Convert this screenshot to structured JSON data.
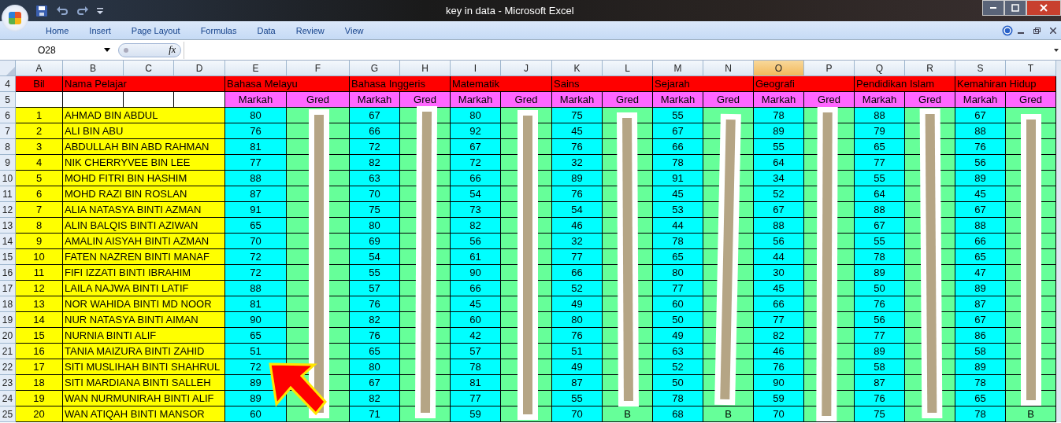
{
  "window": {
    "title": "key in data - Microsoft Excel"
  },
  "ribbon_tabs": [
    {
      "label": "Home",
      "selected": false
    },
    {
      "label": "Insert",
      "selected": false
    },
    {
      "label": "Page Layout",
      "selected": false
    },
    {
      "label": "Formulas",
      "selected": false
    },
    {
      "label": "Data",
      "selected": false
    },
    {
      "label": "Review",
      "selected": false
    },
    {
      "label": "View",
      "selected": false
    }
  ],
  "formula_bar": {
    "name_box": "O28",
    "function_button": "fx"
  },
  "columns": [
    {
      "label": "A",
      "selected": false
    },
    {
      "label": "B",
      "selected": false
    },
    {
      "label": "C",
      "selected": false
    },
    {
      "label": "D",
      "selected": false
    },
    {
      "label": "E",
      "selected": false
    },
    {
      "label": "F",
      "selected": false
    },
    {
      "label": "G",
      "selected": false
    },
    {
      "label": "H",
      "selected": false
    },
    {
      "label": "I",
      "selected": false
    },
    {
      "label": "J",
      "selected": false
    },
    {
      "label": "K",
      "selected": false
    },
    {
      "label": "L",
      "selected": false
    },
    {
      "label": "M",
      "selected": false
    },
    {
      "label": "N",
      "selected": false
    },
    {
      "label": "O",
      "selected": true
    },
    {
      "label": "P",
      "selected": false
    },
    {
      "label": "Q",
      "selected": false
    },
    {
      "label": "R",
      "selected": false
    },
    {
      "label": "S",
      "selected": false
    },
    {
      "label": "T",
      "selected": false
    }
  ],
  "header_rows": [
    "4",
    "5"
  ],
  "header": {
    "number": "Bil",
    "name": "Nama Pelajar"
  },
  "subjects": [
    {
      "name": "Bahasa Melayu",
      "mark_label": "Markah",
      "grade_label": "Gred"
    },
    {
      "name": "Bahasa Inggeris",
      "mark_label": "Markah",
      "grade_label": "Gred"
    },
    {
      "name": "Matematik",
      "mark_label": "Markah",
      "grade_label": "Gred"
    },
    {
      "name": "Sains",
      "mark_label": "Markah",
      "grade_label": "Gred"
    },
    {
      "name": "Sejarah",
      "mark_label": "Markah",
      "grade_label": "Gred"
    },
    {
      "name": "Geografi",
      "mark_label": "Markah",
      "grade_label": "Gred"
    },
    {
      "name": "Pendidikan Islam",
      "mark_label": "Markah",
      "grade_label": "Gred"
    },
    {
      "name": "Kemahiran Hidup",
      "mark_label": "Markah",
      "grade_label": "Gred"
    }
  ],
  "students": [
    {
      "row": "6",
      "no": "1",
      "name": "AHMAD BIN ABDUL",
      "marks": [
        "80",
        "67",
        "80",
        "75",
        "55",
        "78",
        "88",
        "67"
      ]
    },
    {
      "row": "7",
      "no": "2",
      "name": "ALI BIN ABU",
      "marks": [
        "76",
        "66",
        "92",
        "45",
        "67",
        "89",
        "79",
        "88"
      ]
    },
    {
      "row": "8",
      "no": "3",
      "name": "ABDULLAH BIN ABD RAHMAN",
      "marks": [
        "81",
        "72",
        "67",
        "76",
        "66",
        "55",
        "65",
        "76"
      ]
    },
    {
      "row": "9",
      "no": "4",
      "name": "NIK CHERRYVEE BIN LEE",
      "marks": [
        "77",
        "82",
        "72",
        "32",
        "78",
        "64",
        "77",
        "56"
      ]
    },
    {
      "row": "10",
      "no": "5",
      "name": "MOHD FITRI BIN HASHIM",
      "marks": [
        "88",
        "63",
        "66",
        "89",
        "91",
        "34",
        "55",
        "89"
      ]
    },
    {
      "row": "11",
      "no": "6",
      "name": "MOHD RAZI BIN ROSLAN",
      "marks": [
        "87",
        "70",
        "54",
        "76",
        "45",
        "52",
        "64",
        "45"
      ]
    },
    {
      "row": "12",
      "no": "7",
      "name": "ALIA NATASYA BINTI AZMAN",
      "marks": [
        "91",
        "75",
        "73",
        "54",
        "53",
        "67",
        "88",
        "67"
      ]
    },
    {
      "row": "13",
      "no": "8",
      "name": "ALIN BALQIS BINTI AZIWAN",
      "marks": [
        "65",
        "80",
        "82",
        "46",
        "44",
        "88",
        "67",
        "88"
      ]
    },
    {
      "row": "14",
      "no": "9",
      "name": "AMALIN AISYAH BINTI AZMAN",
      "marks": [
        "70",
        "69",
        "56",
        "32",
        "78",
        "56",
        "55",
        "66"
      ]
    },
    {
      "row": "15",
      "no": "10",
      "name": "FATEN NAZREN BINTI MANAF",
      "marks": [
        "72",
        "54",
        "61",
        "77",
        "65",
        "44",
        "78",
        "65"
      ]
    },
    {
      "row": "16",
      "no": "11",
      "name": "FIFI IZZATI BINTI IBRAHIM",
      "marks": [
        "72",
        "55",
        "90",
        "66",
        "80",
        "30",
        "89",
        "47"
      ]
    },
    {
      "row": "17",
      "no": "12",
      "name": "LAILA NAJWA BINTI LATIF",
      "marks": [
        "88",
        "57",
        "66",
        "52",
        "77",
        "45",
        "50",
        "89"
      ]
    },
    {
      "row": "18",
      "no": "13",
      "name": "NOR WAHIDA BINTI MD NOOR",
      "marks": [
        "81",
        "76",
        "45",
        "49",
        "60",
        "66",
        "76",
        "87"
      ]
    },
    {
      "row": "19",
      "no": "14",
      "name": "NUR NATASYA BINTI AIMAN",
      "marks": [
        "90",
        "82",
        "60",
        "80",
        "50",
        "77",
        "56",
        "67"
      ]
    },
    {
      "row": "20",
      "no": "15",
      "name": "NURNIA BINTI ALIF",
      "marks": [
        "65",
        "76",
        "42",
        "76",
        "49",
        "82",
        "77",
        "86"
      ]
    },
    {
      "row": "21",
      "no": "16",
      "name": "TANIA MAIZURA BINTI ZAHID",
      "marks": [
        "51",
        "65",
        "57",
        "51",
        "63",
        "46",
        "89",
        "58"
      ]
    },
    {
      "row": "22",
      "no": "17",
      "name": "SITI MUSLIHAH BINTI SHAHRUL",
      "marks": [
        "72",
        "80",
        "78",
        "49",
        "52",
        "76",
        "58",
        "89"
      ]
    },
    {
      "row": "23",
      "no": "18",
      "name": "SITI MARDIANA BINTI SALLEH",
      "marks": [
        "89",
        "67",
        "81",
        "87",
        "50",
        "90",
        "87",
        "78"
      ]
    },
    {
      "row": "24",
      "no": "19",
      "name": "WAN NURMUNIRAH BINTI ALIF",
      "marks": [
        "89",
        "82",
        "77",
        "55",
        "78",
        "59",
        "76",
        "65"
      ]
    },
    {
      "row": "25",
      "no": "20",
      "name": "WAN ATIQAH BINTI MANSOR",
      "cells": [
        {
          "mark": "60"
        },
        {
          "mark": "71"
        },
        {
          "mark": "59"
        },
        {
          "mark": "70",
          "grade": "B"
        },
        {
          "mark": "68",
          "grade": "B"
        },
        {
          "mark": "70"
        },
        {
          "mark": "75"
        },
        {
          "mark": "78",
          "grade": "B"
        }
      ]
    }
  ]
}
